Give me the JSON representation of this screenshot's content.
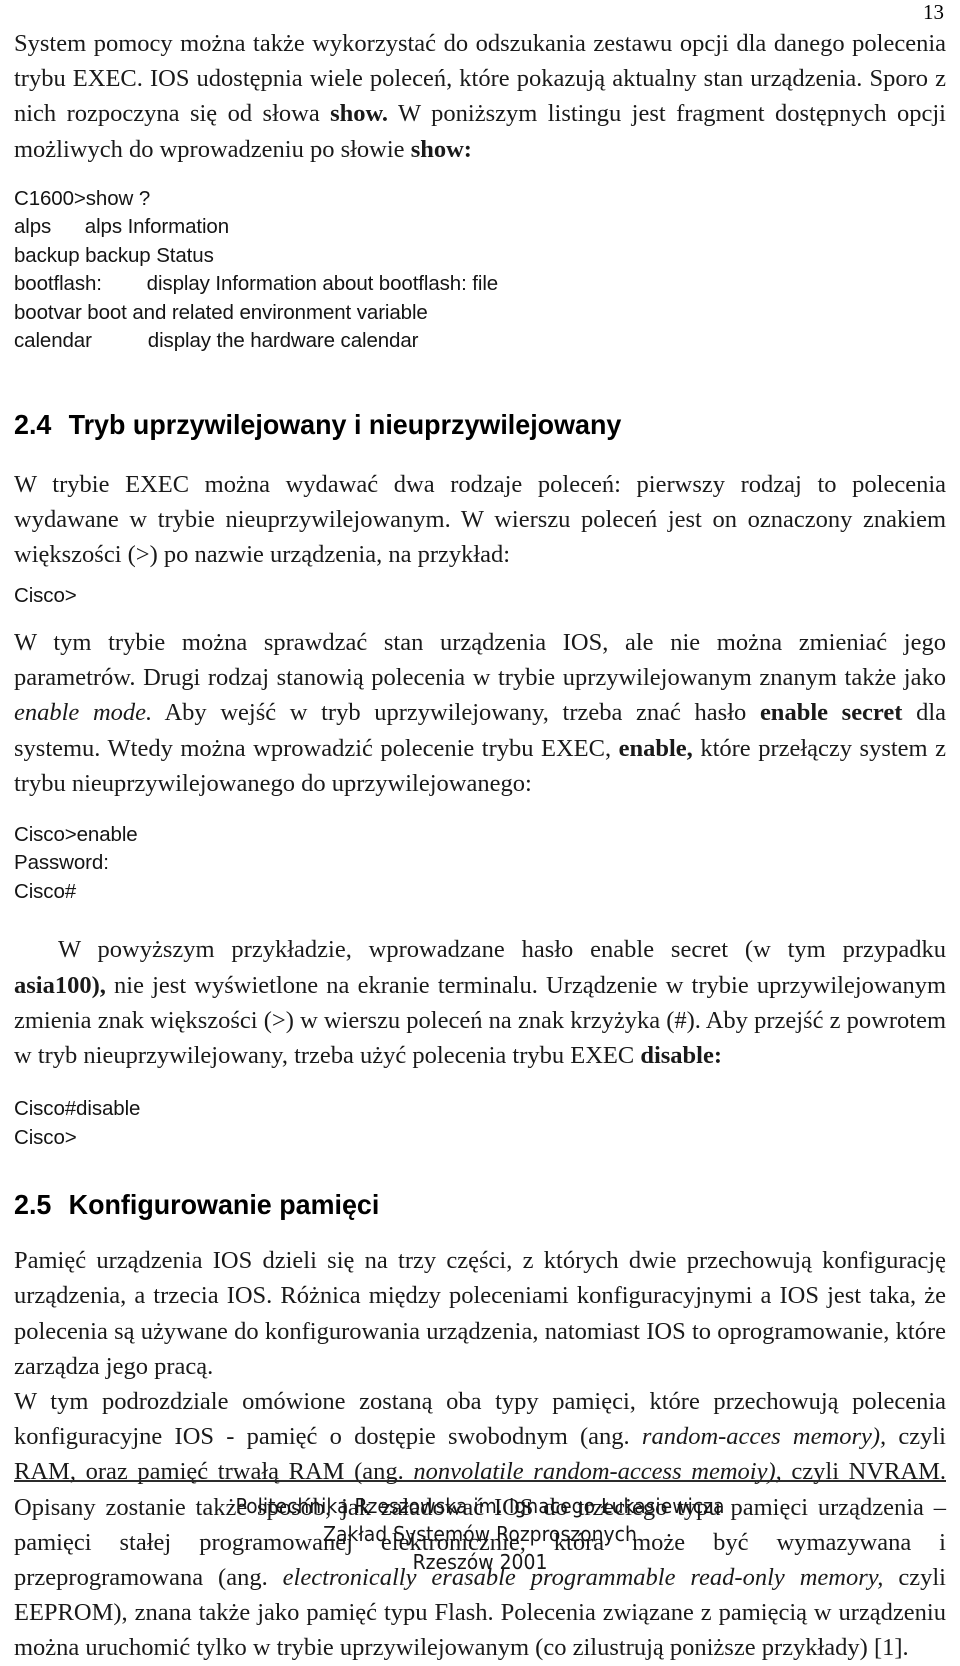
{
  "page": {
    "number": "13"
  },
  "body": {
    "intro_paragraph": {
      "segments": [
        {
          "text": "System pomocy można także wykorzystać do odszukania zestawu opcji dla danego polecenia trybu EXEC. IOS udostępnia wiele poleceń, które pokazują aktualny stan urządzenia. Sporo z nich rozpoczyna się od słowa ",
          "style": "normal"
        },
        {
          "text": "show.",
          "style": "bold"
        },
        {
          "text": " W poniższym listingu jest fragment dostępnych opcji możliwych do wprowadzeniu po słowie ",
          "style": "normal"
        },
        {
          "text": "show:",
          "style": "bold"
        }
      ]
    },
    "listing_show": "C1600>show ?\nalps      alps Information\nbackup backup Status\nbootflash:        display Information about bootflash: file\nbootvar boot and related environment variable\ncalendar          display the hardware calendar",
    "heading_24": {
      "number": "2.4",
      "title": "Tryb uprzywilejowany i nieuprzywilejowany"
    },
    "paragraph_exec_modes": {
      "segments": [
        {
          "text": "W trybie EXEC można wydawać dwa rodzaje poleceń: pierwszy rodzaj to polecenia wydawane w trybie nieuprzywilejowanym. W wierszu poleceń jest on oznaczony znakiem większości (>) po nazwie urządzenia, na przykład:",
          "style": "normal"
        }
      ]
    },
    "listing_prompt_user": "Cisco>",
    "paragraph_enable_mode": {
      "segments": [
        {
          "text": "W tym trybie można sprawdzać stan urządzenia IOS, ale nie można zmieniać jego parametrów. Drugi rodzaj stanowią polecenia w trybie uprzywilejowanym znanym także jako ",
          "style": "normal"
        },
        {
          "text": "enable mode.",
          "style": "italic"
        },
        {
          "text": " Aby wejść w tryb uprzywilejowany, trzeba znać hasło ",
          "style": "normal"
        },
        {
          "text": "enable secret",
          "style": "bold"
        },
        {
          "text": " dla systemu. Wtedy można wprowadzić polecenie trybu EXEC, ",
          "style": "normal"
        },
        {
          "text": "enable,",
          "style": "bold"
        },
        {
          "text": " które przełączy system z trybu nieuprzywilejowanego do uprzywilejowanego:",
          "style": "normal"
        }
      ]
    },
    "listing_enable": "Cisco>enable\nPassword:\nCisco#",
    "paragraph_password_note": {
      "segments": [
        {
          "text": "W powyższym przykładzie, wprowadzane hasło enable secret (w tym przypadku ",
          "style": "normal"
        },
        {
          "text": "asia100),",
          "style": "bold"
        },
        {
          "text": " nie jest wyświetlone na ekranie terminalu. Urządzenie w trybie uprzywilejowanym zmienia znak większości (>) w wierszu poleceń na znak krzyżyka (#). Aby przejść z powrotem w tryb nieuprzywilejowany, trzeba użyć polecenia trybu EXEC ",
          "style": "normal"
        },
        {
          "text": "disable:",
          "style": "bold"
        }
      ]
    },
    "listing_disable": "Cisco#disable\nCisco>",
    "heading_25": {
      "number": "2.5",
      "title": "Konfigurowanie pamięci"
    },
    "paragraph_memory_intro": {
      "segments": [
        {
          "text": "Pamięć urządzenia IOS dzieli się na trzy części, z których dwie przechowują konfigurację urządzenia, a trzecia IOS. Różnica między poleceniami konfiguracyjnymi a IOS jest taka, że polecenia są używane do konfigurowania urządzenia, natomiast IOS to oprogramowanie, które zarządza jego pracą.",
          "style": "normal"
        }
      ]
    },
    "paragraph_memory_types": {
      "segments": [
        {
          "text": "W tym podrozdziale omówione zostaną oba typy pamięci, które przechowują polecenia konfiguracyjne IOS - pamięć o dostępie swobodnym (ang. ",
          "style": "normal"
        },
        {
          "text": "random-acces memory),",
          "style": "italic"
        },
        {
          "text": " czyli RAM, oraz pamięć trwałą RAM (ang. ",
          "style": "normal"
        },
        {
          "text": "nonvolatile random-access memoiy),",
          "style": "italic"
        },
        {
          "text": " czyli NVRAM. Opisany zostanie także sposób, jak załadować IOS do trzeciego typu pamięci urządzenia – pamięci stałej programowanej elektronicznie, która może być wymazywana i przeprogramowana (ang. ",
          "style": "normal"
        },
        {
          "text": "electronically erasable programmable read-only memory,",
          "style": "italic"
        },
        {
          "text": " czyli EEPROM), znana także jako pamięć typu Flash. Polecenia związane z pamięcią w urządzeniu można uruchomić tylko w trybie uprzywilejowanym (co zilustrują poniższe przykłady) [1].",
          "style": "normal"
        }
      ]
    }
  },
  "footer": {
    "line1": "Politechnika Rzeszowska im. Ignacego Łukasiewicza",
    "line2": "Zakład Systemów Rozproszonych",
    "line3": "Rzeszów 2001"
  }
}
